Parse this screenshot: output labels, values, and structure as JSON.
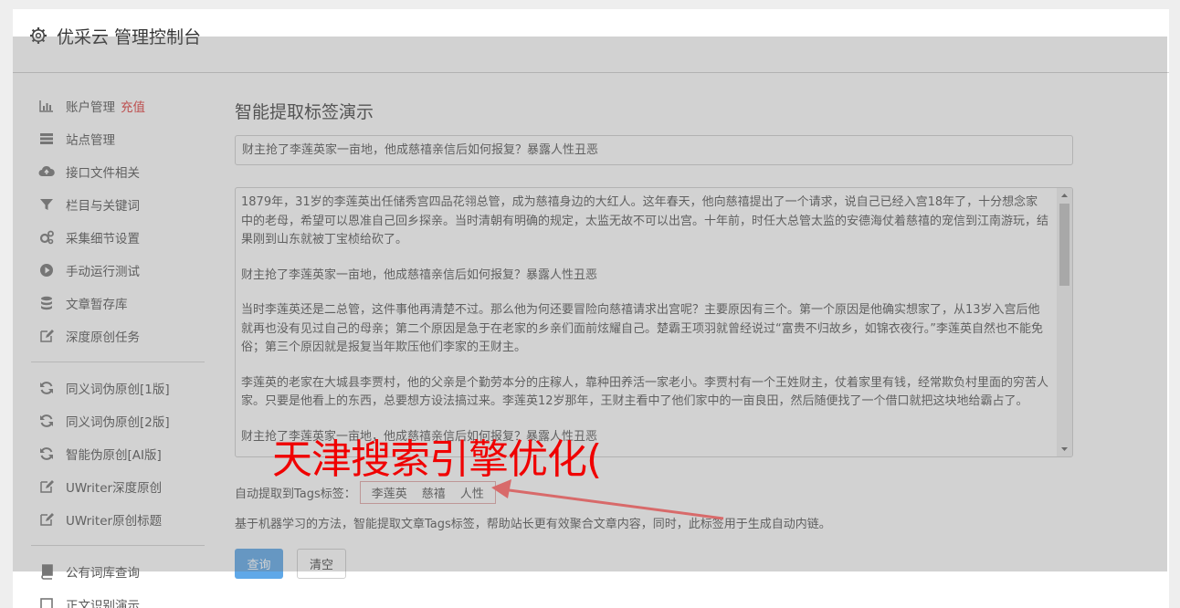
{
  "header": {
    "title": "优采云 管理控制台",
    "icon": "gear-icon"
  },
  "sidebar": {
    "group1": [
      {
        "label": "账户管理",
        "extra": "充值",
        "icon": "bar-chart-icon"
      },
      {
        "label": "站点管理",
        "icon": "list-icon"
      },
      {
        "label": "接口文件相关",
        "icon": "cloud-upload-icon"
      },
      {
        "label": "栏目与关键词",
        "icon": "filter-icon"
      },
      {
        "label": "采集细节设置",
        "icon": "cogs-icon"
      },
      {
        "label": "手动运行测试",
        "icon": "play-icon"
      },
      {
        "label": "文章暂存库",
        "icon": "database-icon"
      },
      {
        "label": "深度原创任务",
        "icon": "edit-icon"
      }
    ],
    "group2": [
      {
        "label": "同义词伪原创[1版]",
        "icon": "refresh-icon"
      },
      {
        "label": "同义词伪原创[2版]",
        "icon": "refresh-icon"
      },
      {
        "label": "智能伪原创[AI版]",
        "icon": "refresh-icon"
      },
      {
        "label": "UWriter深度原创",
        "icon": "edit-icon"
      },
      {
        "label": "UWriter原创标题",
        "icon": "edit-icon"
      }
    ],
    "group3": [
      {
        "label": "公有词库查询",
        "icon": "book-icon"
      },
      {
        "label": "正文识别演示",
        "icon": "square-icon"
      }
    ]
  },
  "main": {
    "page_title": "智能提取标签演示",
    "title_value": "财主抢了李莲英家一亩地，他成慈禧亲信后如何报复？暴露人性丑恶",
    "article_paragraphs": [
      "1879年，31岁的李莲英出任储秀宫四品花翎总管，成为慈禧身边的大红人。这年春天，他向慈禧提出了一个请求，说自己已经入宫18年了，十分想念家中的老母，希望可以恩准自己回乡探亲。当时清朝有明确的规定，太监无故不可以出宫。十年前，时任大总管太监的安德海仗着慈禧的宠信到江南游玩，结果刚到山东就被丁宝桢给砍了。",
      "财主抢了李莲英家一亩地，他成慈禧亲信后如何报复？暴露人性丑恶",
      "当时李莲英还是二总管，这件事他再清楚不过。那么他为何还要冒险向慈禧请求出宫呢？主要原因有三个。第一个原因是他确实想家了，从13岁入宫后他就再也没有见过自己的母亲；第二个原因是急于在老家的乡亲们面前炫耀自己。楚霸王项羽就曾经说过“富贵不归故乡，如锦衣夜行。”李莲英自然也不能免俗；第三个原因就是报复当年欺压他们李家的王财主。",
      "李莲英的老家在大城县李贾村，他的父亲是个勤劳本分的庄稼人，靠种田养活一家老小。李贾村有一个王姓财主，仗着家里有钱，经常欺负村里面的穷苦人家。只要是他看上的东西，总要想方设法搞过来。李莲英12岁那年，王财主看中了他们家中的一亩良田，然后随便找了一个借口就把这块地给霸占了。",
      "财主抢了李莲英家一亩地，他成慈禧亲信后如何报复？暴露人性丑恶"
    ],
    "tags_label": "自动提取到Tags标签：",
    "tags": [
      "李莲英",
      "慈禧",
      "人性"
    ],
    "description": "基于机器学习的方法，智能提取文章Tags标签，帮助站长更有效聚合文章内容，同时，此标签用于生成自动内链。",
    "query_button": "查询",
    "clear_button": "清空"
  },
  "watermark": {
    "text": "天津搜索引擎优化(",
    "color": "#f00000"
  },
  "colors": {
    "accent": "#5fa8e8",
    "warn": "#e03d3d"
  }
}
